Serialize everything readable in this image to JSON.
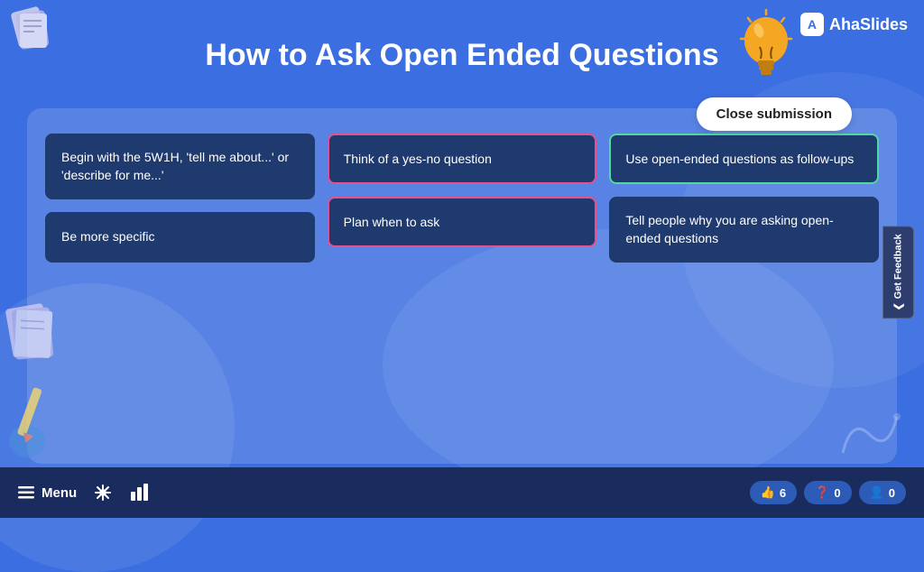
{
  "logo": {
    "icon_label": "A",
    "text": "AhaSlides"
  },
  "title": "How to Ask Open Ended Questions",
  "close_button_label": "Close submission",
  "cards": [
    {
      "id": "card-1",
      "text": "Begin with the 5W1H, 'tell me about...' or 'describe for me...'",
      "highlighted": "",
      "column": 0
    },
    {
      "id": "card-2",
      "text": "Be more specific",
      "highlighted": "",
      "column": 0
    },
    {
      "id": "card-3",
      "text": "Think of a yes-no question",
      "highlighted": "pink",
      "column": 1
    },
    {
      "id": "card-4",
      "text": "Plan when to ask",
      "highlighted": "pink",
      "column": 1
    },
    {
      "id": "card-5",
      "text": "Use open-ended questions as follow-ups",
      "highlighted": "green",
      "column": 2
    },
    {
      "id": "card-6",
      "text": "Tell people why you are asking open-ended questions",
      "highlighted": "",
      "column": 2
    }
  ],
  "bottom_bar": {
    "menu_label": "Menu",
    "stats": [
      {
        "icon": "👍",
        "value": "6"
      },
      {
        "icon": "❓",
        "value": "0"
      },
      {
        "icon": "👤",
        "value": "0"
      }
    ]
  },
  "feedback_tab": "Get Feedback"
}
